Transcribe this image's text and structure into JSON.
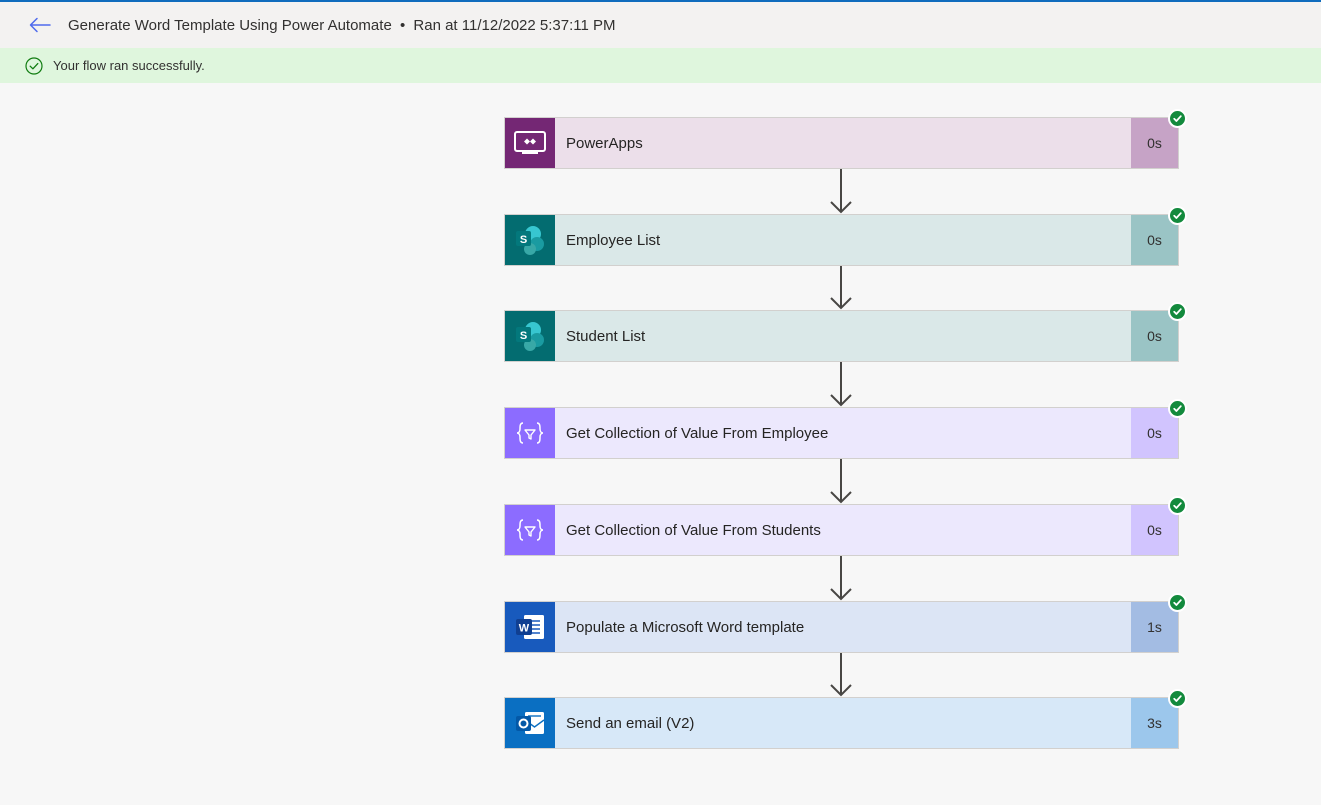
{
  "header": {
    "flow_name": "Generate Word Template Using Power Automate",
    "separator": "•",
    "run_time": "Ran at 11/12/2022 5:37:11 PM"
  },
  "status": {
    "message": "Your flow ran successfully."
  },
  "steps": [
    {
      "label": "PowerApps",
      "duration": "0s",
      "icon": "powerapps-icon",
      "icon_bg": "#742774",
      "body_bg": "#ecdfea",
      "duration_bg": "#c6a3c6"
    },
    {
      "label": "Employee List",
      "duration": "0s",
      "icon": "sharepoint-icon",
      "icon_bg": "#036c70",
      "body_bg": "#dae8e8",
      "duration_bg": "#9ac4c5"
    },
    {
      "label": "Student List",
      "duration": "0s",
      "icon": "sharepoint-icon",
      "icon_bg": "#036c70",
      "body_bg": "#dae8e8",
      "duration_bg": "#9ac4c5"
    },
    {
      "label": "Get Collection of Value From Employee",
      "duration": "0s",
      "icon": "data-operation-icon",
      "icon_bg": "#8c6cff",
      "body_bg": "#ece8fd",
      "duration_bg": "#d1c4fe"
    },
    {
      "label": "Get Collection of Value From Students",
      "duration": "0s",
      "icon": "data-operation-icon",
      "icon_bg": "#8c6cff",
      "body_bg": "#ece8fd",
      "duration_bg": "#d1c4fe"
    },
    {
      "label": "Populate a Microsoft Word template",
      "duration": "1s",
      "icon": "word-icon",
      "icon_bg": "#185abd",
      "body_bg": "#dce5f5",
      "duration_bg": "#a3bce3"
    },
    {
      "label": "Send an email (V2)",
      "duration": "3s",
      "icon": "outlook-icon",
      "icon_bg": "#0a6fc2",
      "body_bg": "#d7e8f8",
      "duration_bg": "#9cc7ec"
    }
  ],
  "colors": {
    "success_green": "#138a3d",
    "accent_blue": "#0f6cbd",
    "status_bg": "#dff6dd"
  }
}
